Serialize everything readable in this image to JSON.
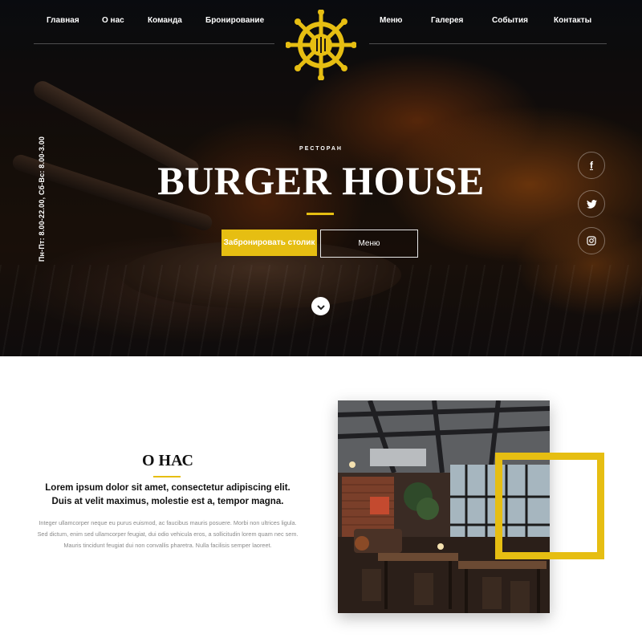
{
  "nav": {
    "left": [
      "Главная",
      "О нас",
      "Команда",
      "Бронирование"
    ],
    "right": [
      "Меню",
      "Галерея",
      "События",
      "Контакты"
    ]
  },
  "logo": {
    "icon": "ship-wheel-icon",
    "color": "#e6be12"
  },
  "hero": {
    "eyebrow": "РЕСТОРАН",
    "title": "BURGER HOUSE",
    "hours": "Пн-Пт: 8.00-22.00, Сб-Вс: 8.00-3.00",
    "book_button": "Забронировать столик",
    "menu_button": "Меню"
  },
  "social": [
    {
      "name": "facebook",
      "glyph": "f"
    },
    {
      "name": "twitter",
      "glyph": "🐦"
    },
    {
      "name": "instagram",
      "glyph": "◎"
    }
  ],
  "about": {
    "title": "О НАС",
    "lead": "Lorem ipsum dolor sit amet, consectetur adipiscing elit. Duis at velit maximus, molestie est a, tempor magna.",
    "body": "Integer ullamcorper neque eu purus euismod, ac faucibus mauris posuere. Morbi non ultrices ligula. Sed dictum, enim sed ullamcorper feugiat, dui odio vehicula eros, a sollicitudin lorem quam nec sem. Mauris tincidunt feugiat dui non convallis pharetra. Nulla facilisis semper laoreet."
  },
  "colors": {
    "accent": "#e6be12",
    "text_dark": "#111111",
    "text_muted": "#8a8a8a"
  }
}
